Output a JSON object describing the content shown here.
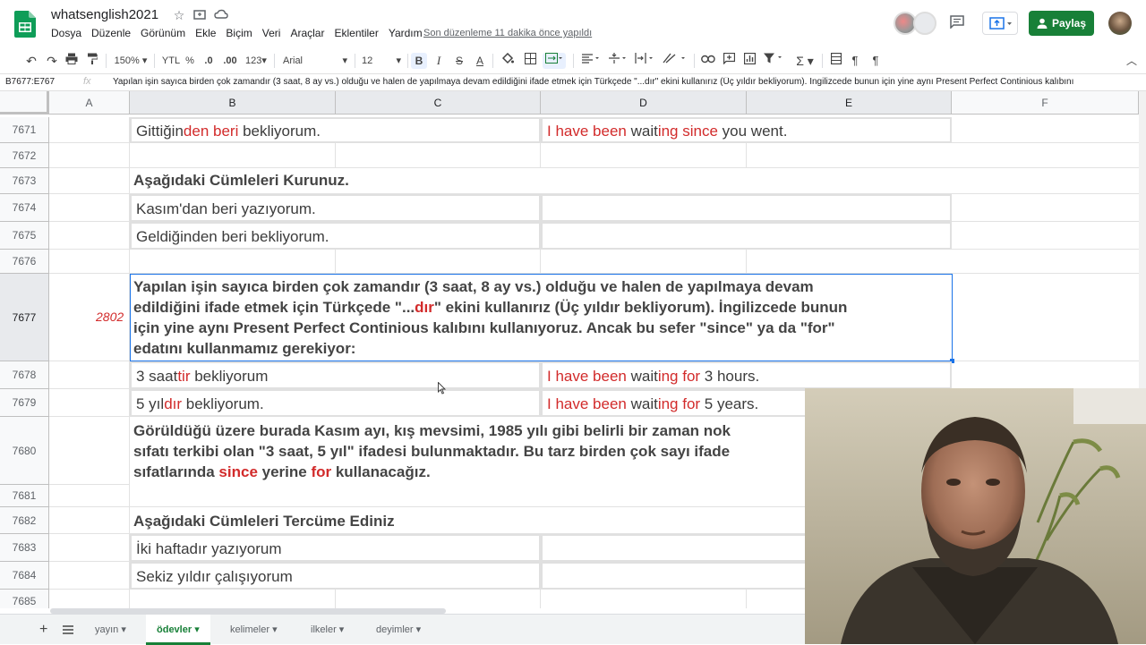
{
  "app": {
    "doc_title": "whatsenglish2021",
    "menus": [
      "Dosya",
      "Düzenle",
      "Görünüm",
      "Ekle",
      "Biçim",
      "Veri",
      "Araçlar",
      "Eklentiler",
      "Yardım"
    ],
    "last_edit": "Son düzenleme 11 dakika önce yapıldı",
    "share_label": "Paylaş",
    "brand_color": "#188038"
  },
  "toolbar": {
    "zoom": "150%",
    "currency": "YTL",
    "percent": "%",
    "dec_decrease": ".0",
    "dec_increase": ".00",
    "more_formats": "123",
    "font": "Arial",
    "font_size": "12",
    "bold": "B",
    "italic": "I",
    "strike": "S",
    "text_color": "A"
  },
  "formula_bar": {
    "name_box": "B7677:E767",
    "fx": "fx",
    "content": "Yapılan işin sayıca birden çok zamandır (3 saat, 8 ay vs.) olduğu ve halen de yapılmaya devam edildiğini ifade etmek için Türkçede \"...dır\" ekini kullanırız (Üç yıldır bekliyorum). İngilizcede bunun için yine aynı Present Perfect Continious kalıbını"
  },
  "columns": [
    "A",
    "B",
    "C",
    "D",
    "E",
    "F"
  ],
  "rows": {
    "r7671": "7671",
    "r7672": "7672",
    "r7673": "7673",
    "r7674": "7674",
    "r7675": "7675",
    "r7676": "7676",
    "r7677": "7677",
    "r7678": "7678",
    "r7679": "7679",
    "r7680": "7680",
    "r7681": "7681",
    "r7682": "7682",
    "r7683": "7683",
    "r7684": "7684",
    "r7685": "7685"
  },
  "cells": {
    "b7671": [
      "Gittiğin",
      "den beri",
      " bekliyorum."
    ],
    "d7671": [
      "I ",
      "have been",
      " wait",
      "ing since",
      " you went."
    ],
    "b7673": "Aşağıdaki Cümleleri Kurunuz.",
    "b7674": "Kasım'dan beri yazıyorum.",
    "b7675": "Geldiğinden beri bekliyorum.",
    "a7677": "2802",
    "b7677_line1": "Yapılan işin sayıca birden çok zamandır (3 saat, 8 ay vs.) olduğu ve halen de yapılmaya devam",
    "b7677_line2": [
      "edildiğini ifade etmek için Türkçede \"...",
      "dır",
      "\" ekini kullanırız (Üç yıldır bekliyorum). İngilizcede bunun"
    ],
    "b7677_line3": "için yine aynı Present Perfect Continious kalıbını kullanıyoruz. Ancak bu sefer \"since\" ya da \"for\"",
    "b7677_line4": "edatını kullanmamız gerekiyor:",
    "b7678": [
      "3 saat",
      "tir",
      " bekliyorum"
    ],
    "d7678": [
      "I ",
      "have been",
      " wait",
      "ing for",
      " 3 hours."
    ],
    "b7679": [
      "5 yıl",
      "dır",
      " bekliyorum."
    ],
    "d7679": [
      "I ",
      "have been",
      " wait",
      "ing for",
      " 5 years."
    ],
    "b7680_line1": "Görüldüğü üzere burada Kasım ayı, kış mevsimi, 1985 yılı gibi belirli bir zaman nok",
    "b7680_line2": "sıfatı terkibi olan \"3 saat, 5 yıl\" ifadesi bulunmaktadır. Bu tarz birden çok sayı ifade",
    "b7680_line3": [
      "sıfatlarında ",
      "since",
      " yerine ",
      "for",
      " kullanacağız."
    ],
    "b7682": "Aşağıdaki Cümleleri Tercüme Ediniz",
    "b7683": "İki haftadır yazıyorum",
    "b7684": "Sekiz yıldır çalışıyorum"
  },
  "sheets": [
    {
      "label": "yayın",
      "active": false
    },
    {
      "label": "ödevler",
      "active": true
    },
    {
      "label": "kelimeler",
      "active": false
    },
    {
      "label": "ilkeler",
      "active": false
    },
    {
      "label": "deyimler",
      "active": false
    }
  ],
  "colors": {
    "accent_red": "#d22b2b",
    "selection_blue": "#1a73e8"
  },
  "icons": [
    "sheets-logo-icon",
    "star-icon",
    "move-icon",
    "cloud-icon",
    "comment-icon",
    "present-icon",
    "person-icon",
    "undo-icon",
    "redo-icon",
    "print-icon",
    "paint-format-icon",
    "add-sheet-icon",
    "sheet-list-icon",
    "dropdown-icon"
  ]
}
